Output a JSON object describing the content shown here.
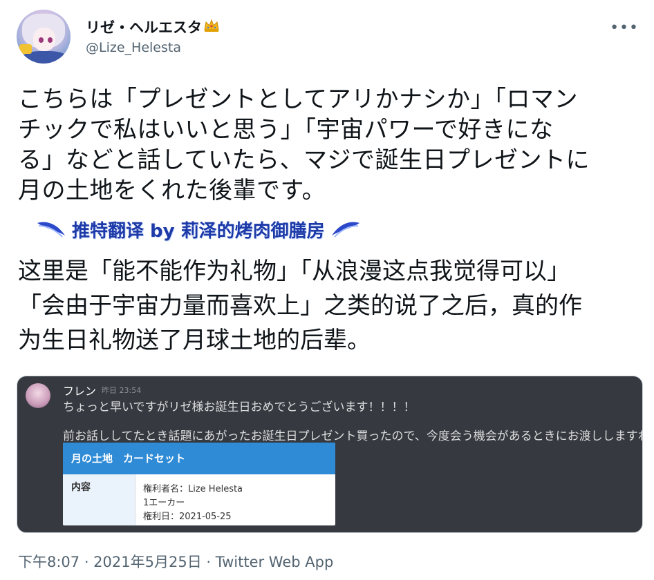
{
  "author": {
    "display_name": "リゼ・ヘルエスタ",
    "badge_icon": "crown-icon",
    "username": "@Lize_Helesta"
  },
  "menu": {
    "more_label": "•••"
  },
  "tweet": {
    "lines": [
      "こちらは「プレゼントとしてアリかナシか」「ロマン",
      "チックで私はいいと思う」「宇宙パワーで好きにな",
      "る」などと話していたら、マジで誕生日プレゼントに",
      "月の土地をくれた後輩です。"
    ]
  },
  "translation": {
    "banner": "推特翻译 by 莉泽的烤肉御膳房",
    "lines": [
      "这里是「能不能作为礼物」「从浪漫这点我觉得可以」",
      "「会由于宇宙力量而喜欢上」之类的说了之后，真的作",
      "为生日礼物送了月球土地的后辈。"
    ]
  },
  "media": {
    "author": "フレン",
    "time": "昨日 23:54",
    "message1": "ちょっと早いですがリゼ様お誕生日おめでとうございます！！！！",
    "message2": "前お話ししてたとき話題にあがったお誕生日プレゼント買ったので、今度会う機会があるときにお渡ししますね",
    "message2_emoji": "🌙😘",
    "card": {
      "title": "月の土地　カードセット",
      "label": "内容",
      "values": [
        "権利者名：Lize Helesta",
        "1エーカー",
        "権利日：2021-05-25"
      ]
    }
  },
  "footer": {
    "timestamp": "下午8:07 · 2021年5月25日 · Twitter Web App"
  }
}
